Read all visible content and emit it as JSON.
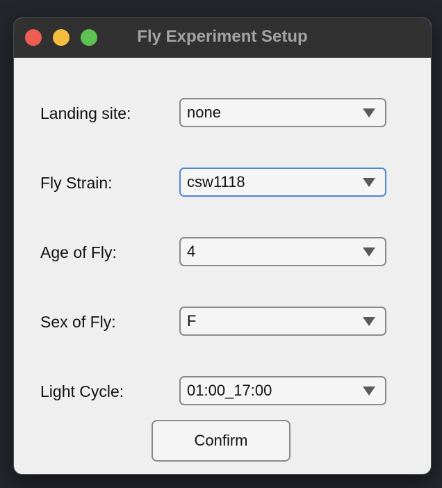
{
  "window": {
    "title": "Fly Experiment Setup"
  },
  "form": {
    "fields": [
      {
        "label": "Landing site:",
        "value": "none"
      },
      {
        "label": "Fly Strain:",
        "value": "csw1118"
      },
      {
        "label": "Age of Fly:",
        "value": "4"
      },
      {
        "label": "Sex of Fly:",
        "value": "F"
      },
      {
        "label": "Light Cycle:",
        "value": "01:00_17:00"
      }
    ],
    "confirm_label": "Confirm"
  },
  "colors": {
    "titlebar": "#313131",
    "window_bg": "#efefef",
    "focus_border": "#4f86d6",
    "close": "#ee5d52",
    "minimize": "#f5bc3f",
    "maximize": "#5ec153"
  },
  "icons": [
    "close-button",
    "minimize-button",
    "maximize-button",
    "chevron-down-icon"
  ]
}
